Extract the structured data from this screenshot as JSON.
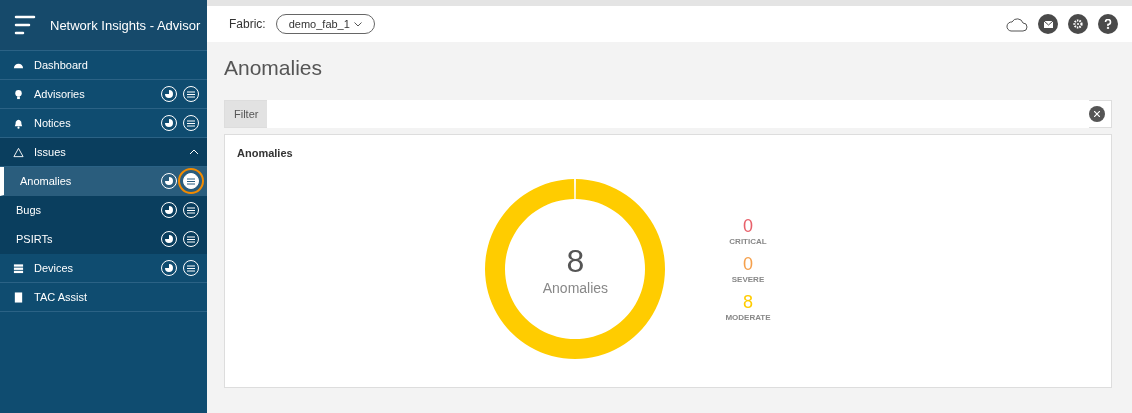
{
  "app": {
    "title": "Network Insights - Advisor"
  },
  "sidebar": {
    "items": [
      {
        "label": "Dashboard",
        "actions": false,
        "selected": false
      },
      {
        "label": "Advisories",
        "actions": true,
        "selected": false
      },
      {
        "label": "Notices",
        "actions": true,
        "selected": false
      },
      {
        "label": "Issues",
        "actions": false,
        "selected": false,
        "expanded": true,
        "children": [
          {
            "label": "Anomalies",
            "actions": true,
            "selected": true,
            "list_highlighted": true
          },
          {
            "label": "Bugs",
            "actions": true,
            "selected": false,
            "list_highlighted": false
          },
          {
            "label": "PSIRTs",
            "actions": true,
            "selected": false,
            "list_highlighted": false
          }
        ]
      },
      {
        "label": "Devices",
        "actions": true,
        "selected": false
      },
      {
        "label": "TAC Assist",
        "actions": false,
        "selected": false
      }
    ]
  },
  "topbar": {
    "fabric_label": "Fabric:",
    "fabric_value": "demo_fab_1"
  },
  "page": {
    "title": "Anomalies",
    "filter": {
      "label": "Filter"
    },
    "card": {
      "title": "Anomalies",
      "total": "8",
      "total_label": "Anomalies",
      "legend": [
        {
          "count": "0",
          "label": "CRITICAL",
          "color": "#e8606a"
        },
        {
          "count": "0",
          "label": "SEVERE",
          "color": "#f5a04c"
        },
        {
          "count": "8",
          "label": "MODERATE",
          "color": "#ffcc00"
        }
      ]
    }
  }
}
